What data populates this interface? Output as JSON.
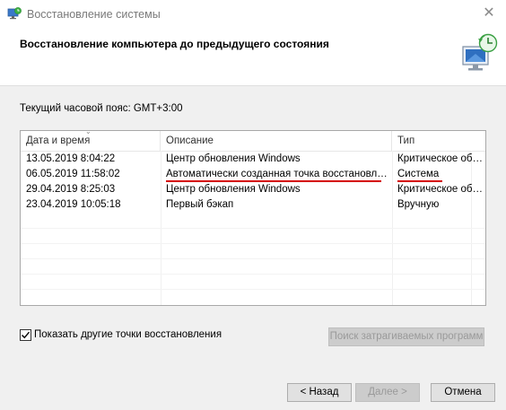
{
  "window": {
    "title": "Восстановление системы",
    "icon": "system-restore-icon"
  },
  "header": {
    "title": "Восстановление компьютера до предыдущего состояния",
    "art_icon": "monitor-restore-icon"
  },
  "timezone_label": "Текущий часовой пояс: GMT+3:00",
  "table": {
    "columns": [
      "Дата и время",
      "Описание",
      "Тип"
    ],
    "rows": [
      {
        "date": "13.05.2019 8:04:22",
        "desc": "Центр обновления Windows",
        "type": "Критическое обновление"
      },
      {
        "date": "06.05.2019 11:58:02",
        "desc": "Автоматически созданная точка восстановления",
        "type": "Система"
      },
      {
        "date": "29.04.2019 8:25:03",
        "desc": "Центр обновления Windows",
        "type": "Критическое обновление"
      },
      {
        "date": "23.04.2019 10:05:18",
        "desc": "Первый бэкап",
        "type": "Вручную"
      }
    ],
    "annotation_color": "#d40000"
  },
  "show_more": {
    "label": "Показать другие точки восстановления",
    "checked": true
  },
  "buttons": {
    "scan": "Поиск затрагиваемых программ",
    "back": "< Назад",
    "next": "Далее >",
    "cancel": "Отмена"
  }
}
